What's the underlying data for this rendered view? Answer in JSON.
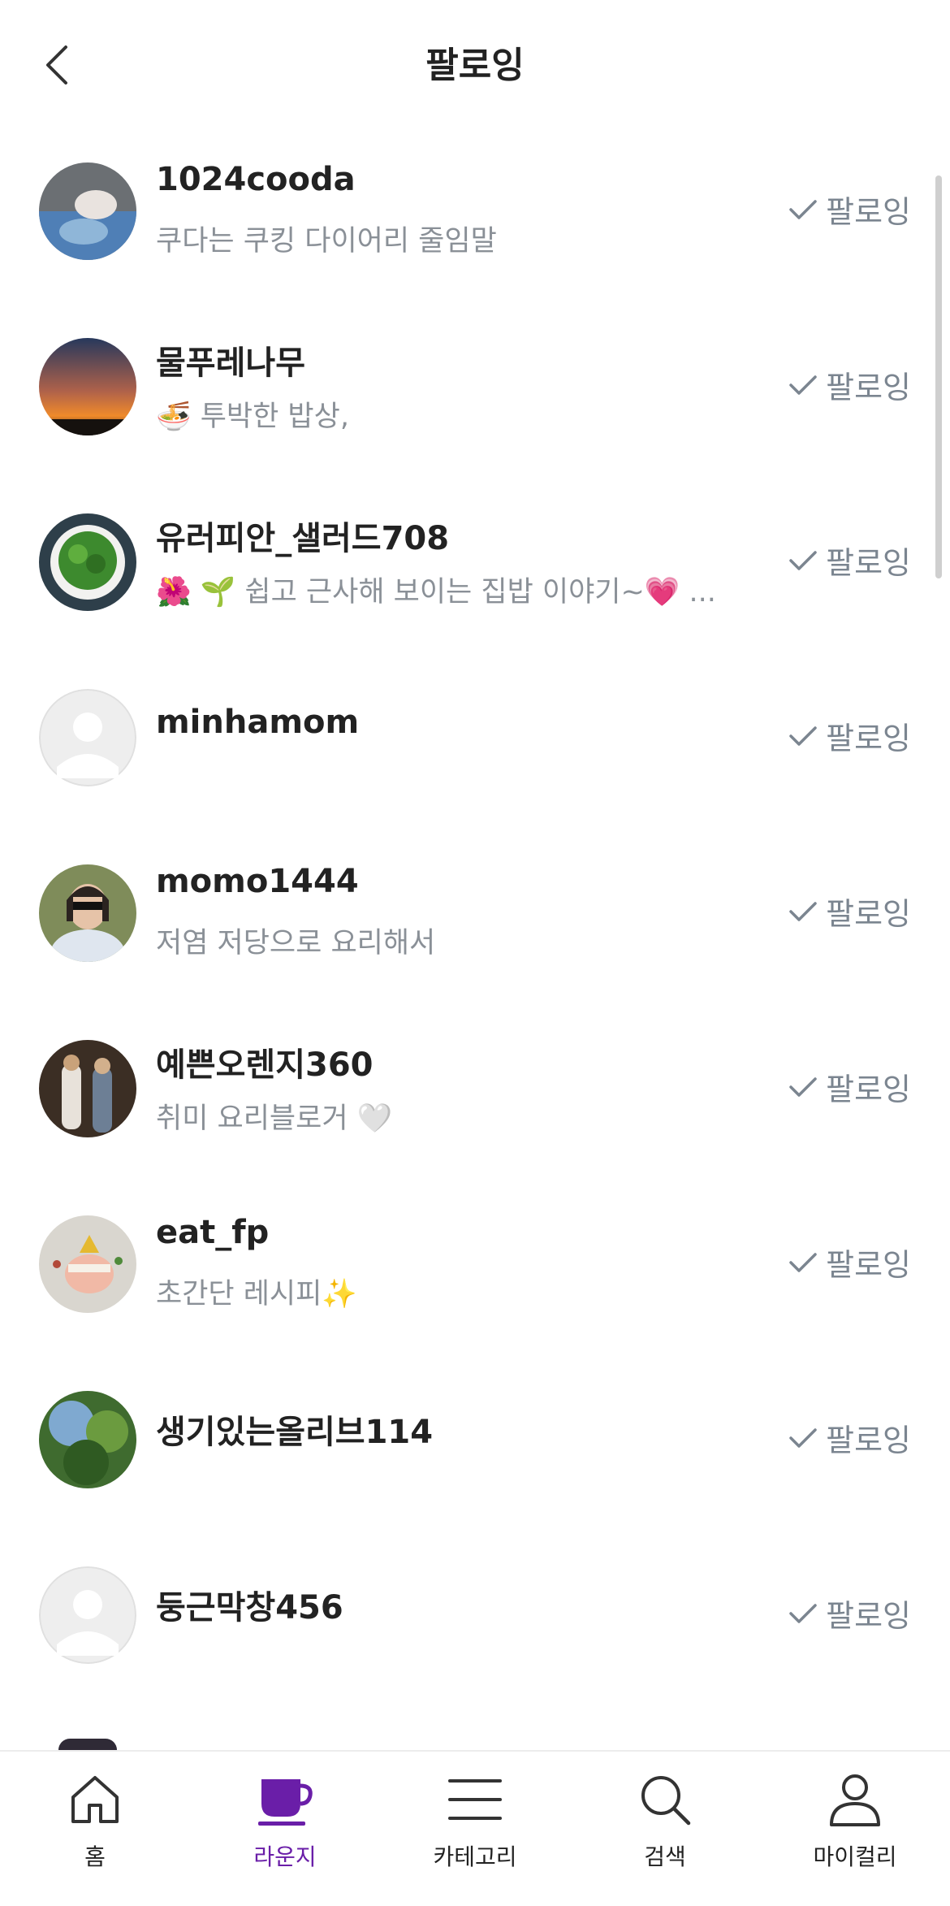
{
  "header": {
    "title": "팔로잉"
  },
  "following": [
    {
      "name": "1024cooda",
      "description": "쿠다는 쿠킹 다이어리 줄임말",
      "button": "팔로잉"
    },
    {
      "name": "물푸레나무",
      "description": "🍜 투박한 밥상,",
      "button": "팔로잉"
    },
    {
      "name": "유러피안_샐러드708",
      "description": "🌺 🌱 쉽고 근사해 보이는 집밥 이야기~💗 ...",
      "button": "팔로잉"
    },
    {
      "name": "minhamom",
      "description": "",
      "button": "팔로잉"
    },
    {
      "name": "momo1444",
      "description": "저염 저당으로 요리해서",
      "button": "팔로잉"
    },
    {
      "name": "예쁜오렌지360",
      "description": "취미 요리블로거 🤍",
      "button": "팔로잉"
    },
    {
      "name": "eat_fp",
      "description": "초간단 레시피✨",
      "button": "팔로잉"
    },
    {
      "name": "생기있는올리브114",
      "description": "",
      "button": "팔로잉"
    },
    {
      "name": "둥근막창456",
      "description": "",
      "button": "팔로잉"
    }
  ],
  "tabbar": {
    "home": "홈",
    "lounge": "라운지",
    "category": "카테고리",
    "search": "검색",
    "my": "마이컬리"
  },
  "colors": {
    "accent": "#6a1ea8",
    "muted": "#8a9097"
  }
}
